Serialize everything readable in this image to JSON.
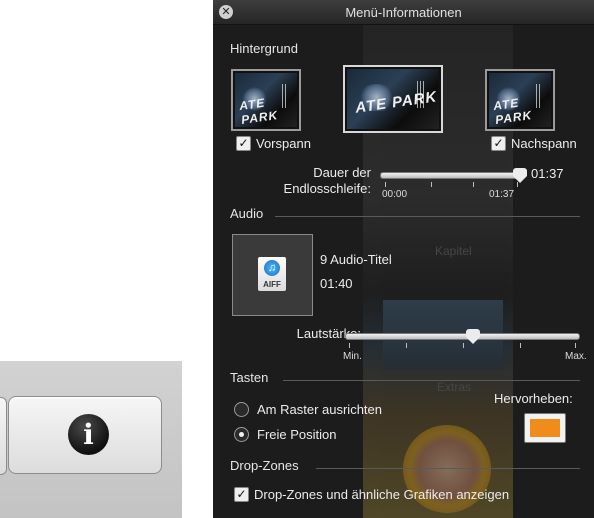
{
  "window": {
    "title": "Menü-Informationen",
    "close_icon": "close-circle-icon"
  },
  "hintergrund": {
    "section_label": "Hintergrund",
    "thumbnail_text": "ATE PARK",
    "vorspann_label": "Vorspann",
    "vorspann_checked": true,
    "nachspann_label": "Nachspann",
    "nachspann_checked": true
  },
  "loop_duration": {
    "label_line1": "Dauer der",
    "label_line2": "Endlosschleife:",
    "value": "01:37",
    "min_label": "00:00",
    "max_label": "01:37",
    "slider_fraction": 1.0
  },
  "audio": {
    "section_label": "Audio",
    "file_type": "AIFF",
    "file_icon": "music-note-icon",
    "title_count": "9 Audio-Titel",
    "duration": "01:40",
    "volume_label": "Lautstärke:",
    "volume_min": "Min.",
    "volume_max": "Max.",
    "volume_fraction": 0.55
  },
  "tasten": {
    "section_label": "Tasten",
    "option_grid": "Am Raster ausrichten",
    "option_free": "Freie Position",
    "selected": "Freie Position",
    "highlight_label": "Hervorheben:",
    "highlight_color": "#f08c1a"
  },
  "dropzones": {
    "section_label": "Drop-Zones",
    "show_label": "Drop-Zones und ähnliche Grafiken anzeigen",
    "show_checked": true
  },
  "background_preview": {
    "kapitel": "Kapitel",
    "extras": "Extras"
  },
  "toolbar": {
    "info_icon": "info-icon",
    "info_glyph": "i"
  }
}
